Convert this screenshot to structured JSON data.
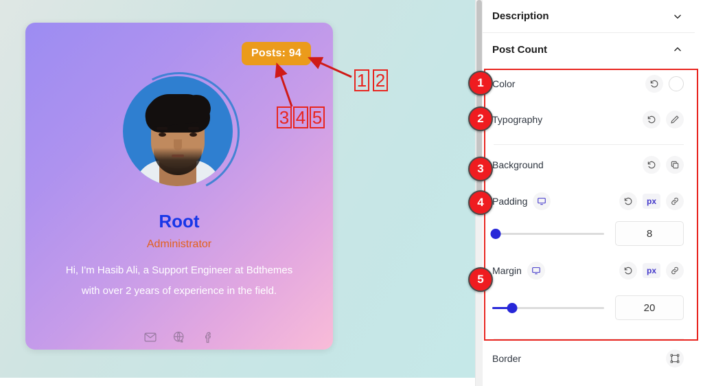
{
  "preview": {
    "card": {
      "badge_label": "Posts: 94",
      "name": "Root",
      "role": "Administrator",
      "bio_line1": "Hi, I'm Hasib Ali, a Support Engineer at Bdthemes",
      "bio_line2": "with over 2 years of experience in the field.",
      "socials": [
        "email-icon",
        "globe-icon",
        "facebook-icon"
      ],
      "colors": {
        "badge_bg": "#eb9b1b",
        "name_color": "#1736e8",
        "role_color": "#e2601d",
        "bio_color": "#ffffff",
        "avatar_ring": "#2f7fd0"
      }
    },
    "canvas_bg": "#cfe4e2"
  },
  "annotations": {
    "accent_color": "#e8251f",
    "boxes_top": [
      "1",
      "2"
    ],
    "boxes_mid": [
      "3",
      "4",
      "5"
    ],
    "markers": [
      "1",
      "2",
      "3",
      "4",
      "5"
    ]
  },
  "panel": {
    "sections": [
      {
        "title": "Description",
        "state_icon": "chevron-down-icon"
      },
      {
        "title": "Post Count",
        "state_icon": "chevron-up-icon"
      }
    ],
    "controls": {
      "color": {
        "label": "Color",
        "reset_icon": "reset-icon",
        "swatch_icon": "color-swatch-icon",
        "swatch_value": "#ffffff"
      },
      "typography": {
        "label": "Typography",
        "reset_icon": "reset-icon",
        "edit_icon": "pencil-icon"
      },
      "background": {
        "label": "Background",
        "reset_icon": "reset-icon",
        "layers_icon": "layers-icon"
      },
      "padding": {
        "label": "Padding",
        "device_icon": "desktop-icon",
        "reset_icon": "reset-icon",
        "unit": "px",
        "link_icon": "link-icon",
        "value": "8",
        "slider_percent": 3
      },
      "margin": {
        "label": "Margin",
        "device_icon": "desktop-icon",
        "reset_icon": "reset-icon",
        "unit": "px",
        "link_icon": "link-icon",
        "value": "20",
        "slider_percent": 18
      },
      "border": {
        "label": "Border",
        "transform_icon": "transform-corners-icon"
      }
    }
  }
}
